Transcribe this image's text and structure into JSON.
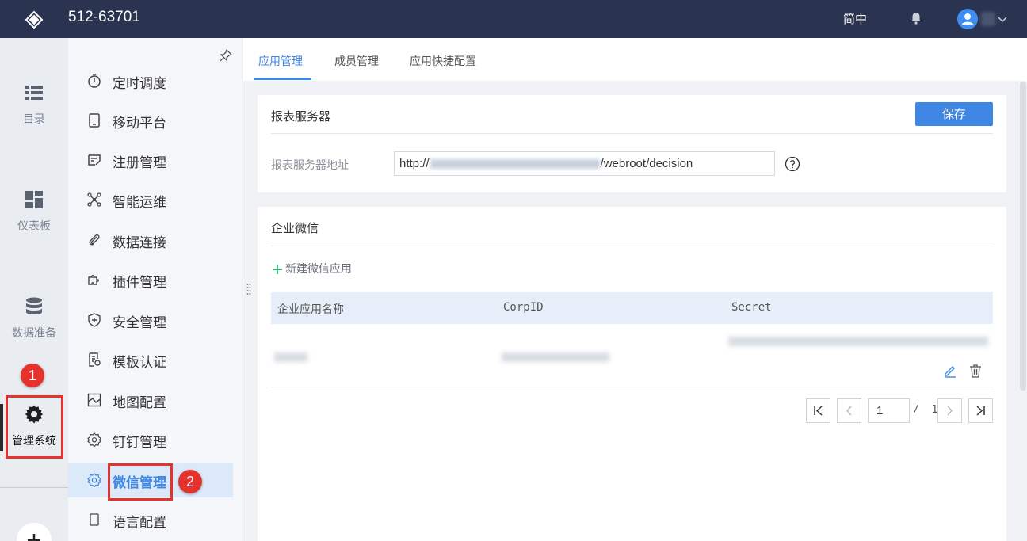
{
  "topbar": {
    "title": "512-63701",
    "lang_label": "简中"
  },
  "rail": {
    "items": [
      {
        "label": "目录",
        "icon": "list-icon"
      },
      {
        "label": "仪表板",
        "icon": "dashboard-icon"
      },
      {
        "label": "数据准备",
        "icon": "database-icon"
      },
      {
        "label": "管理系统",
        "icon": "gear-icon",
        "active": true
      }
    ]
  },
  "annotations": {
    "badge1": "1",
    "badge2": "2",
    "color": "#e5322d"
  },
  "menu": {
    "items": [
      {
        "label": "定时调度",
        "icon": "timer-icon"
      },
      {
        "label": "移动平台",
        "icon": "mobile-icon"
      },
      {
        "label": "注册管理",
        "icon": "register-icon"
      },
      {
        "label": "智能运维",
        "icon": "network-icon"
      },
      {
        "label": "数据连接",
        "icon": "paperclip-icon"
      },
      {
        "label": "插件管理",
        "icon": "puzzle-icon"
      },
      {
        "label": "安全管理",
        "icon": "shield-icon"
      },
      {
        "label": "模板认证",
        "icon": "template-icon"
      },
      {
        "label": "地图配置",
        "icon": "map-icon"
      },
      {
        "label": "钉钉管理",
        "icon": "gear-outline-icon"
      },
      {
        "label": "微信管理",
        "icon": "gear-outline-icon",
        "active": true
      },
      {
        "label": "语言配置",
        "icon": "language-icon"
      }
    ]
  },
  "tabs": [
    {
      "label": "应用管理",
      "active": true
    },
    {
      "label": "成员管理"
    },
    {
      "label": "应用快捷配置"
    }
  ],
  "report_server": {
    "title": "报表服务器",
    "save_label": "保存",
    "address_label": "报表服务器地址",
    "url_prefix": "http://",
    "url_suffix": "/webroot/decision"
  },
  "wechat": {
    "title": "企业微信",
    "new_app_label": "新建微信应用",
    "columns": [
      "企业应用名称",
      "CorpID",
      "Secret"
    ],
    "pager": {
      "current": "1",
      "separator": "/",
      "total": "1"
    }
  },
  "colors": {
    "accent": "#3e86e3",
    "topbar": "#2a3450",
    "plus_green": "#1fb36b"
  }
}
